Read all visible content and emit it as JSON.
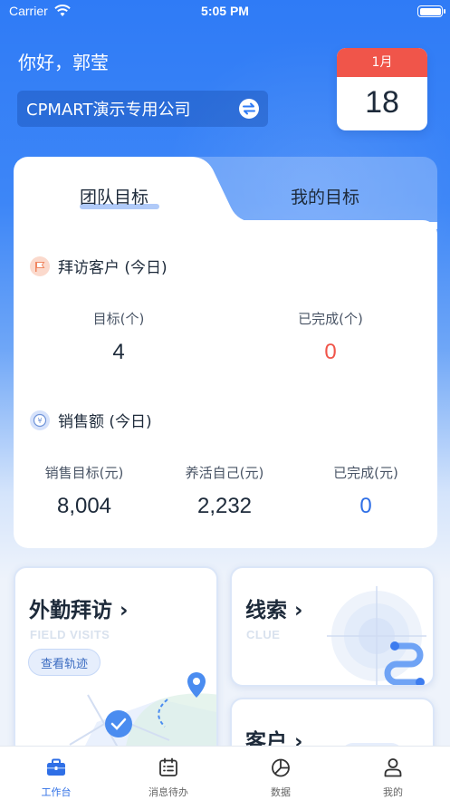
{
  "status_bar": {
    "carrier": "Carrier",
    "time": "5:05 PM"
  },
  "header": {
    "greeting": "你好，郭莹",
    "company": "CPMART演示专用公司"
  },
  "calendar": {
    "month": "1月",
    "day": "18"
  },
  "goals": {
    "tabs": [
      {
        "label": "团队目标",
        "active": true
      },
      {
        "label": "我的目标",
        "active": false
      }
    ],
    "visit": {
      "title": "拜访客户 (今日)",
      "target_label": "目标(个)",
      "target_value": "4",
      "done_label": "已完成(个)",
      "done_value": "0"
    },
    "sales": {
      "title": "销售额 (今日)",
      "target_label": "销售目标(元)",
      "target_value": "8,004",
      "self_label": "养活自己(元)",
      "self_value": "2,232",
      "done_label": "已完成(元)",
      "done_value": "0"
    }
  },
  "cards": {
    "field": {
      "title": "外勤拜访 ›",
      "subtitle": "FIELD VISITS",
      "button": "查看轨迹"
    },
    "clue": {
      "title": "线索 ›",
      "subtitle": "CLUE"
    },
    "customer": {
      "title": "客户 ›"
    }
  },
  "tabbar": [
    {
      "label": "工作台",
      "icon": "briefcase-icon",
      "active": true
    },
    {
      "label": "消息待办",
      "icon": "calendar-list-icon",
      "active": false
    },
    {
      "label": "数据",
      "icon": "pie-chart-icon",
      "active": false
    },
    {
      "label": "我的",
      "icon": "user-icon",
      "active": false
    }
  ],
  "colors": {
    "primary": "#2f7bf6",
    "accent_red": "#f0554a",
    "value_red": "#f0554a",
    "value_blue": "#2f6fe6"
  }
}
